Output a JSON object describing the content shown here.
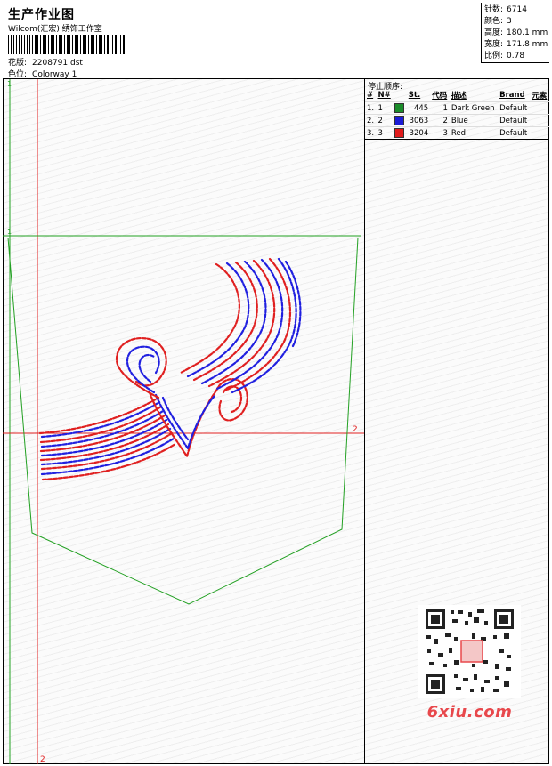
{
  "header": {
    "title": "生产作业图",
    "subtitle": "Wilcom(汇宏) 绣饰工作室",
    "design_label": "花版:",
    "design_value": "2208791.dst",
    "colorway_label": "色位:",
    "colorway_value": "Colorway 1"
  },
  "stats": {
    "stitches_label": "针数:",
    "stitches_value": "6714",
    "colors_label": "颜色:",
    "colors_value": "3",
    "height_label": "高度:",
    "height_value": "180.1 mm",
    "width_label": "宽度:",
    "width_value": "171.8 mm",
    "scale_label": "比例:",
    "scale_value": "0.78"
  },
  "stop_sequence": {
    "title": "停止顺序:",
    "columns": [
      "#",
      "N#",
      "",
      "St.",
      "代码",
      "描述",
      "Brand",
      "元素"
    ],
    "rows": [
      {
        "idx": "1.",
        "n": "1",
        "color": "#1a8c2a",
        "st": "445",
        "code": "1",
        "desc": "Dark Green",
        "brand": "Default"
      },
      {
        "idx": "2.",
        "n": "2",
        "color": "#1b1bd6",
        "st": "3063",
        "code": "2",
        "desc": "Blue",
        "brand": "Default"
      },
      {
        "idx": "3.",
        "n": "3",
        "color": "#e01b1b",
        "st": "3204",
        "code": "3",
        "desc": "Red",
        "brand": "Default"
      }
    ]
  },
  "canvas": {
    "marker_top_left": "1",
    "marker_hline_left": "1",
    "marker_hline_right": "2",
    "marker_bottom": "2",
    "colors": {
      "green": "#22a022",
      "red": "#e02020",
      "blue": "#2020e0"
    }
  },
  "watermark": {
    "brand_text": "6xiu.com"
  }
}
